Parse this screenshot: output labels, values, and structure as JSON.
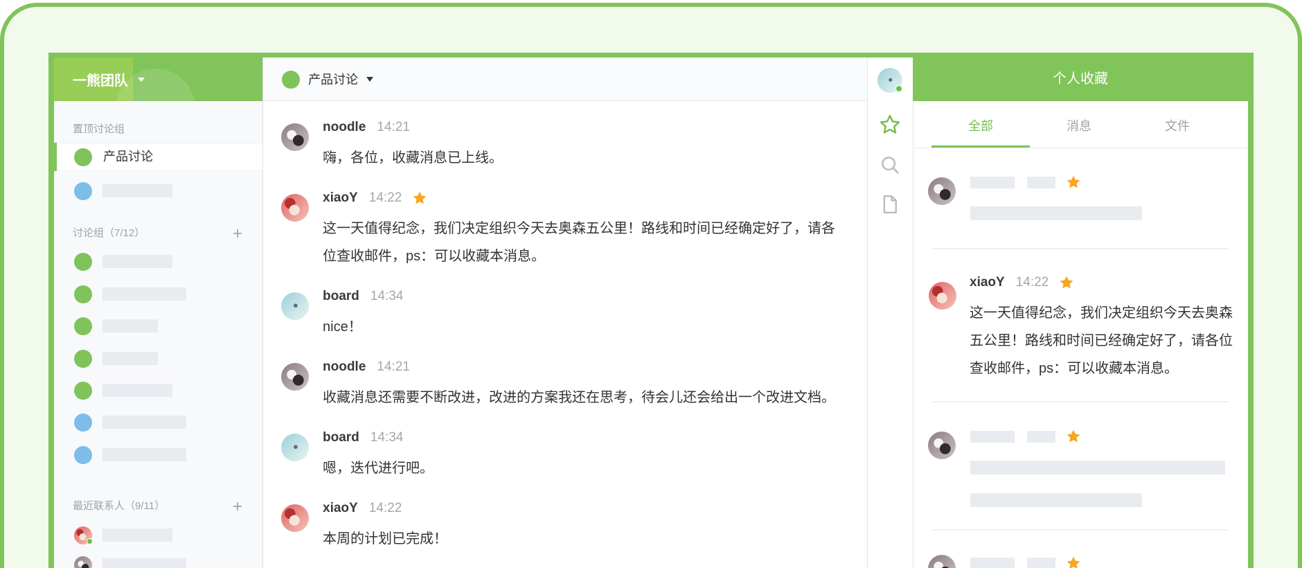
{
  "team": {
    "name": "一熊团队"
  },
  "sidebar": {
    "pinned_label": "置顶讨论组",
    "pinned": [
      {
        "label": "产品讨论",
        "color": "#7fc35a",
        "active": true
      },
      {
        "color": "#7dbde9"
      }
    ],
    "groups_label": "讨论组（7/12）",
    "groups": [
      {
        "color": "#7fc35a"
      },
      {
        "color": "#7fc35a"
      },
      {
        "color": "#7fc35a"
      },
      {
        "color": "#7fc35a"
      },
      {
        "color": "#7fc35a"
      },
      {
        "color": "#7dbde9"
      },
      {
        "color": "#7dbde9"
      }
    ],
    "recent_label": "最近联系人（9/11）"
  },
  "channel": {
    "name": "产品讨论",
    "color": "#7fc35a"
  },
  "messages": [
    {
      "user": "noodle",
      "time": "14:21",
      "text": "嗨，各位，收藏消息已上线。",
      "starred": false
    },
    {
      "user": "xiaoY",
      "time": "14:22",
      "text": "这一天值得纪念，我们决定组织今天去奥森五公里！路线和时间已经确定好了，请各位查收邮件，ps：可以收藏本消息。",
      "starred": true
    },
    {
      "user": "board",
      "time": "14:34",
      "text": "nice！",
      "starred": false
    },
    {
      "user": "noodle",
      "time": "14:21",
      "text": "收藏消息还需要不断改进，改进的方案我还在思考，待会儿还会给出一个改进文档。",
      "starred": false
    },
    {
      "user": "board",
      "time": "14:34",
      "text": "嗯，迭代进行吧。",
      "starred": false
    },
    {
      "user": "xiaoY",
      "time": "14:22",
      "text": "本周的计划已完成！",
      "starred": false
    }
  ],
  "rail_icons": [
    "star-icon",
    "search-icon",
    "file-icon"
  ],
  "favorites": {
    "title": "个人收藏",
    "tabs": [
      {
        "label": "全部",
        "active": true
      },
      {
        "label": "消息"
      },
      {
        "label": "文件"
      }
    ],
    "items": [
      {
        "loading": true,
        "starred": true
      },
      {
        "user": "xiaoY",
        "time": "14:22",
        "starred": true,
        "text": "这一天值得纪念，我们决定组织今天去奥森五公里！路线和时间已经确定好了，请各位查收邮件，ps：可以收藏本消息。"
      },
      {
        "loading": true,
        "starred": true
      },
      {
        "loading": true,
        "starred": true
      }
    ]
  },
  "colors": {
    "brand_green": "#80c45a",
    "star_orange": "#f6a623",
    "group_blue": "#7dbde9"
  }
}
